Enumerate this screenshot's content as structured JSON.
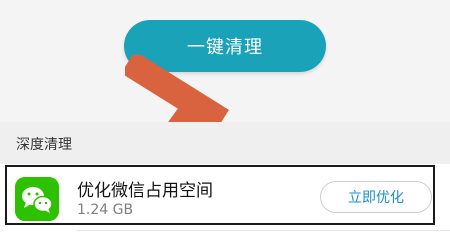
{
  "header": {
    "clean_button_label": "一键清理"
  },
  "deep_clean": {
    "section_title": "深度清理",
    "items": [
      {
        "title": "优化微信占用空间",
        "size": "1.24 GB",
        "action_label": "立即优化",
        "icon": "wechat-icon"
      }
    ]
  },
  "colors": {
    "primary_button": "#1aa3b8",
    "annotation_arrow": "#d9623f",
    "wechat_green": "#2dc100",
    "action_text": "#1a8fc7"
  }
}
